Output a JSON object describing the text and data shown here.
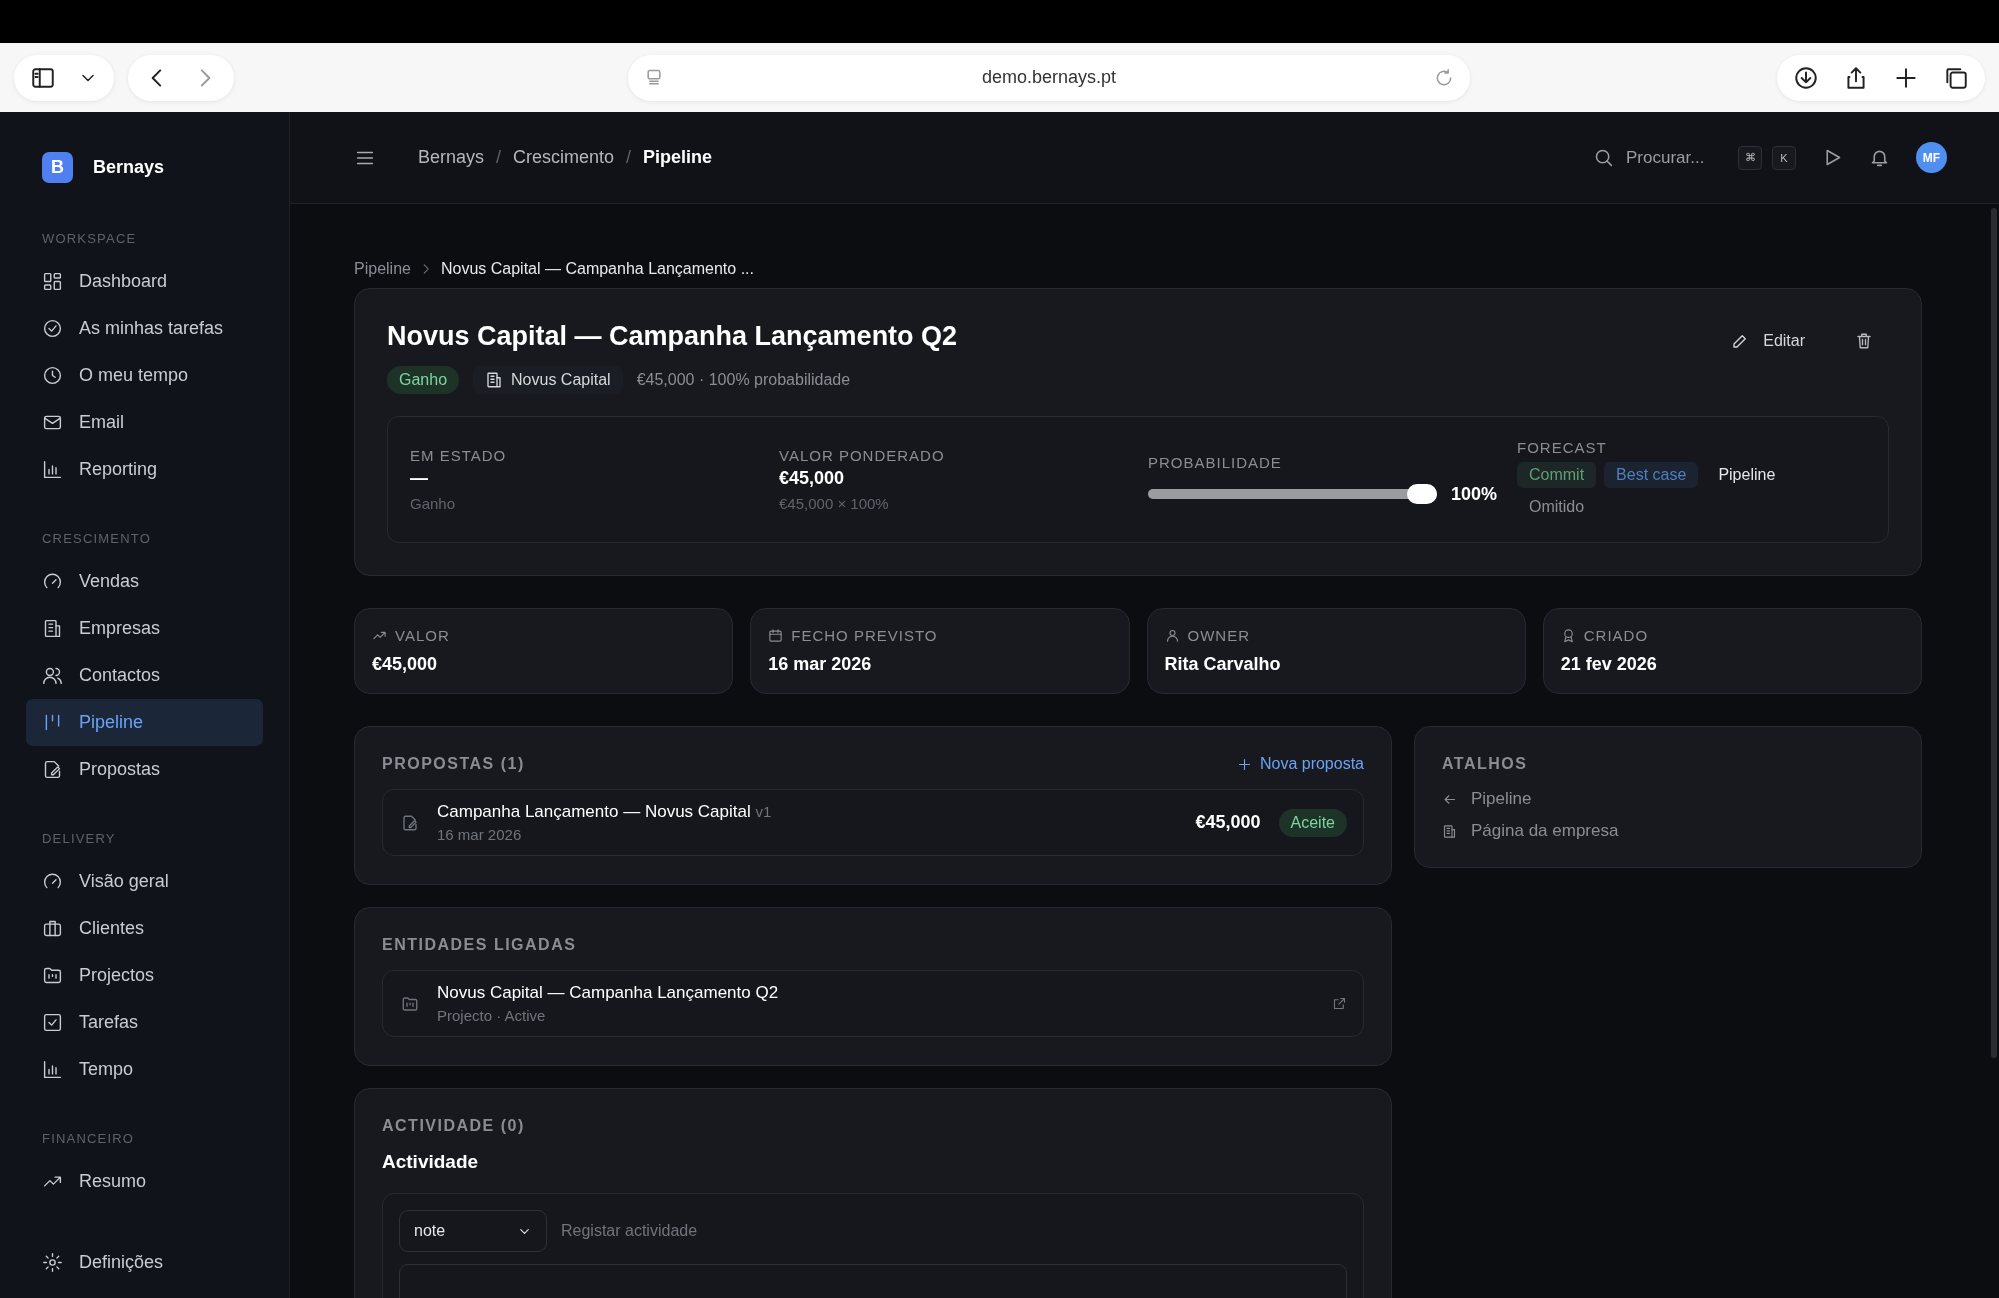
{
  "browser": {
    "url": "demo.bernays.pt"
  },
  "sidebar": {
    "brand_initial": "B",
    "brand": "Bernays",
    "sections": [
      {
        "label": "WORKSPACE",
        "items": [
          {
            "label": "Dashboard",
            "selected": false
          },
          {
            "label": "As minhas tarefas",
            "selected": false
          },
          {
            "label": "O meu tempo",
            "selected": false
          },
          {
            "label": "Email",
            "selected": false
          },
          {
            "label": "Reporting",
            "selected": false
          }
        ]
      },
      {
        "label": "CRESCIMENTO",
        "items": [
          {
            "label": "Vendas",
            "selected": false
          },
          {
            "label": "Empresas",
            "selected": false
          },
          {
            "label": "Contactos",
            "selected": false
          },
          {
            "label": "Pipeline",
            "selected": true
          },
          {
            "label": "Propostas",
            "selected": false
          }
        ]
      },
      {
        "label": "DELIVERY",
        "items": [
          {
            "label": "Visão geral",
            "selected": false
          },
          {
            "label": "Clientes",
            "selected": false
          },
          {
            "label": "Projectos",
            "selected": false
          },
          {
            "label": "Tarefas",
            "selected": false
          },
          {
            "label": "Tempo",
            "selected": false
          }
        ]
      },
      {
        "label": "FINANCEIRO",
        "items": [
          {
            "label": "Resumo",
            "selected": false
          }
        ]
      }
    ],
    "footer_item": "Definições"
  },
  "header": {
    "breadcrumb": [
      "Bernays",
      "Crescimento",
      "Pipeline"
    ],
    "separator": "/",
    "search_placeholder": "Procurar...",
    "shortcut_keys": [
      "⌘",
      "K"
    ],
    "avatar": "MF"
  },
  "page_breadcrumb": [
    "Pipeline",
    "Novus Capital — Campanha Lançamento ..."
  ],
  "deal": {
    "title": "Novus Capital — Campanha Lançamento Q2",
    "status": "Ganho",
    "company": "Novus Capital",
    "summary": "€45,000 · 100% probabilidade",
    "edit_button": "Editar",
    "em_estado": {
      "label": "EM ESTADO",
      "value": "—",
      "sub": "Ganho"
    },
    "valor_ponderado": {
      "label": "VALOR PONDERADO",
      "value": "€45,000",
      "sub": "€45,000 × 100%"
    },
    "probabilidade": {
      "label": "PROBABILIDADE",
      "level": 1,
      "reading": "100%"
    },
    "forecast": {
      "label": "FORECAST",
      "options": [
        {
          "label": "Commit",
          "color": "#5f9f76"
        },
        {
          "label": "Best case",
          "color": "#4f7fc0"
        },
        {
          "label": "Pipeline",
          "color": "#e4e6ea"
        },
        {
          "label": "Omitido",
          "color": "#8b8e95"
        }
      ]
    }
  },
  "stats": [
    {
      "label": "VALOR",
      "value": "€45,000"
    },
    {
      "label": "FECHO PREVISTO",
      "value": "16 mar 2026"
    },
    {
      "label": "OWNER",
      "value": "Rita Carvalho"
    },
    {
      "label": "CRIADO",
      "value": "21 fev 2026"
    }
  ],
  "proposals": {
    "title": "PROPOSTAS (1)",
    "new_button": "Nova proposta",
    "items": [
      {
        "title": "Campanha Lançamento — Novus Capital",
        "version": "v1",
        "date": "16 mar 2026",
        "amount": "€45,000",
        "status": "Aceite"
      }
    ]
  },
  "shortcuts": {
    "title": "ATALHOS",
    "items": [
      "Pipeline",
      "Página da empresa"
    ]
  },
  "linked": {
    "title": "ENTIDADES LIGADAS",
    "items": [
      {
        "title": "Novus Capital — Campanha Lançamento Q2",
        "subtitle": "Projecto · Active"
      }
    ]
  },
  "activity": {
    "title": "ACTIVIDADE (0)",
    "heading": "Actividade",
    "type_select": "note",
    "placeholder": "Registar actividade"
  }
}
